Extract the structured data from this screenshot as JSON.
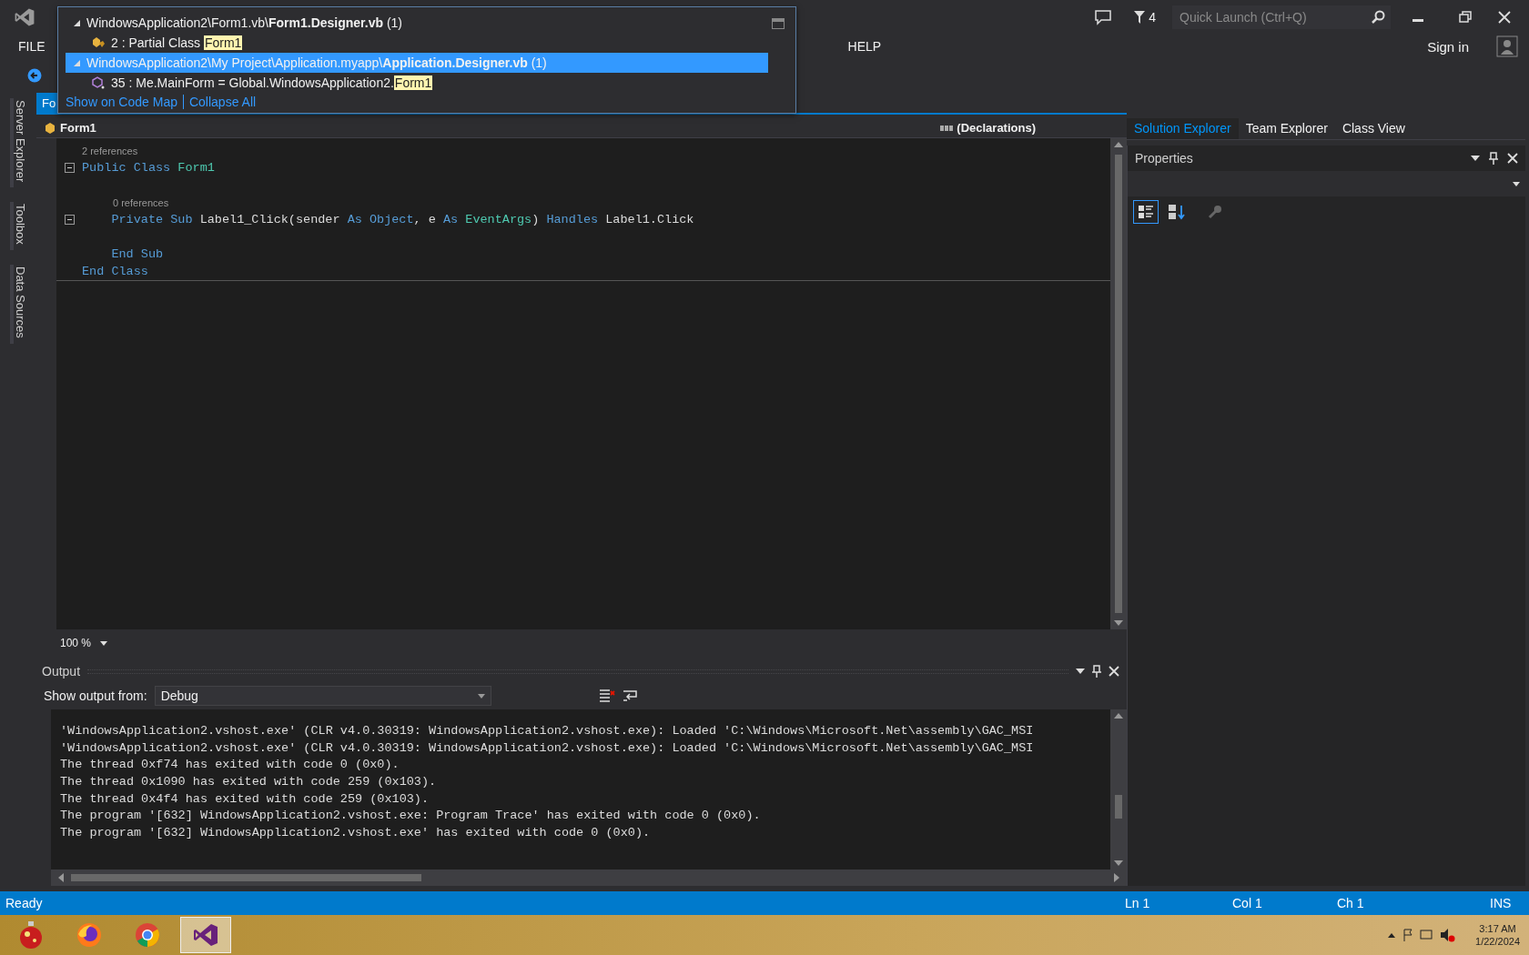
{
  "title_bar": {
    "filter_count": "4",
    "quick_launch": {
      "placeholder": "Quick Launch (Ctrl+Q)"
    }
  },
  "menu": [
    "FILE",
    "HELP"
  ],
  "account": {
    "label": "Sign in"
  },
  "side_tabs": [
    "Server Explorer",
    "Toolbox",
    "Data Sources"
  ],
  "document_tab": {
    "label": "Fo",
    "selected": true
  },
  "navigation": {
    "left": "Form1",
    "right": "(Declarations)"
  },
  "references_popup": {
    "groups": [
      {
        "path": "WindowsApplication2\\Form1.vb\\**Form1.Designer.vb** (1)",
        "expanded": true,
        "selected": false,
        "items": [
          {
            "kind": "class",
            "text": "2 : Partial Class ",
            "match": "Form1"
          }
        ]
      },
      {
        "path": "WindowsApplication2\\My Project\\Application.myapp\\**Application.Designer.vb** (1)",
        "expanded": true,
        "selected": true,
        "items": [
          {
            "kind": "property",
            "text": "35 : Me.MainForm = Global.WindowsApplication2.",
            "match": "Form1"
          }
        ]
      }
    ],
    "links": [
      "Show on Code Map",
      "Collapse All"
    ]
  },
  "code": [
    {
      "kind": "lens",
      "text": "2 references"
    },
    {
      "kind": "code",
      "fold": true,
      "tokens": [
        {
          "t": "Public Class ",
          "kind": "keyword"
        },
        {
          "t": "Form1",
          "kind": "type"
        }
      ]
    },
    {
      "kind": "blank"
    },
    {
      "kind": "lens",
      "text": "0 references"
    },
    {
      "kind": "code",
      "fold": true,
      "tokens": [
        {
          "t": "    Private Sub ",
          "kind": "keyword"
        },
        {
          "t": "Label1_Click(sender ",
          "kind": "plain"
        },
        {
          "t": "As ",
          "kind": "keyword"
        },
        {
          "t": "Object",
          "kind": "keyword"
        },
        {
          "t": ", e ",
          "kind": "plain"
        },
        {
          "t": "As ",
          "kind": "keyword"
        },
        {
          "t": "EventArgs",
          "kind": "type"
        },
        {
          "t": ") ",
          "kind": "plain"
        },
        {
          "t": "Handles ",
          "kind": "keyword"
        },
        {
          "t": "Label1.Click",
          "kind": "plain"
        }
      ]
    },
    {
      "kind": "blank"
    },
    {
      "kind": "code",
      "fold": false,
      "tokens": [
        {
          "t": "    End Sub",
          "kind": "keyword"
        }
      ]
    },
    {
      "kind": "code",
      "fold": false,
      "tokens": [
        {
          "t": "End Class",
          "kind": "keyword"
        }
      ]
    }
  ],
  "zoom": "100 %",
  "output": {
    "title": "Output",
    "source_label": "Show output from:",
    "source": "Debug",
    "lines": [
      "'WindowsApplication2.vshost.exe' (CLR v4.0.30319: WindowsApplication2.vshost.exe): Loaded 'C:\\Windows\\Microsoft.Net\\assembly\\GAC_MSI",
      "'WindowsApplication2.vshost.exe' (CLR v4.0.30319: WindowsApplication2.vshost.exe): Loaded 'C:\\Windows\\Microsoft.Net\\assembly\\GAC_MSI",
      "The thread 0xf74 has exited with code 0 (0x0).",
      "The thread 0x1090 has exited with code 259 (0x103).",
      "The thread 0x4f4 has exited with code 259 (0x103).",
      "The program '[632] WindowsApplication2.vshost.exe: Program Trace' has exited with code 0 (0x0).",
      "The program '[632] WindowsApplication2.vshost.exe' has exited with code 0 (0x0)."
    ]
  },
  "tool_tabs": [
    {
      "label": "Solution Explorer",
      "selected": true
    },
    {
      "label": "Team Explorer",
      "selected": false
    },
    {
      "label": "Class View",
      "selected": false
    }
  ],
  "properties": {
    "title": "Properties"
  },
  "status_bar": {
    "state": "Ready",
    "line": "Ln 1",
    "col": "Col 1",
    "ch": "Ch 1",
    "mode": "INS"
  },
  "taskbar": {
    "apps": [
      {
        "kind": "ornament",
        "selected": false
      },
      {
        "kind": "firefox",
        "selected": false
      },
      {
        "kind": "chrome",
        "selected": false
      },
      {
        "kind": "studio",
        "selected": true
      }
    ],
    "time": "3:17 AM",
    "date": "1/22/2024"
  }
}
